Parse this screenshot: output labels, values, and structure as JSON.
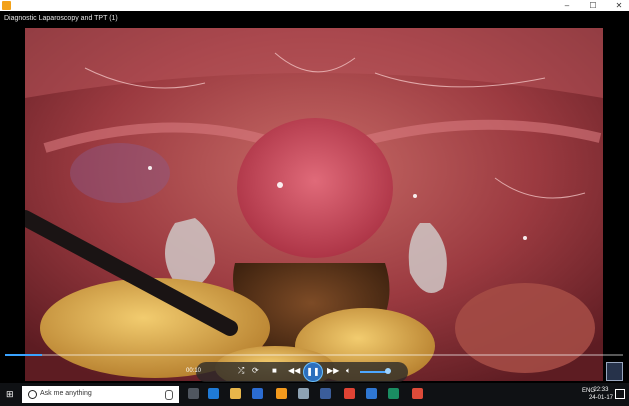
{
  "window": {
    "title": "Diagnostic Laparoscopy and TPT (1)",
    "controls": [
      "–",
      "☐",
      "✕"
    ]
  },
  "player": {
    "elapsed": "00:10",
    "progress_fraction": 0.06,
    "volume_fraction": 0.9
  },
  "taskbar": {
    "search_placeholder": "Ask me anything",
    "language": "ENG",
    "time": "22:33",
    "date": "24-01-17"
  },
  "colors": {
    "accent": "#2c6fbd",
    "progress": "#3aa3ff"
  }
}
